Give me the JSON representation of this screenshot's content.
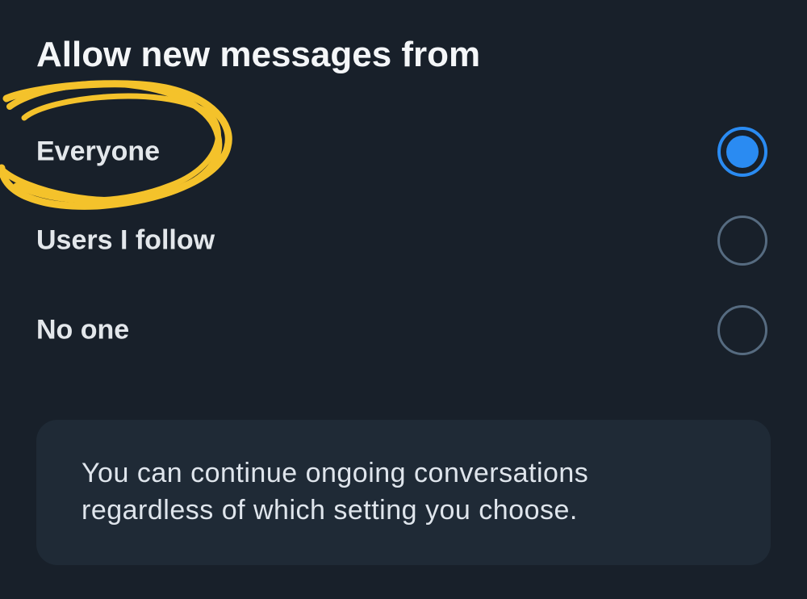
{
  "section": {
    "title": "Allow new messages from"
  },
  "options": [
    {
      "label": "Everyone",
      "selected": true
    },
    {
      "label": "Users I follow",
      "selected": false
    },
    {
      "label": "No one",
      "selected": false
    }
  ],
  "info": {
    "line1": "You can continue ongoing conversations",
    "line2": "regardless of which setting you choose."
  },
  "colors": {
    "background": "#18202a",
    "accent": "#2a8bf2",
    "highlight": "#f4c22b",
    "info_box": "#1f2a36"
  }
}
